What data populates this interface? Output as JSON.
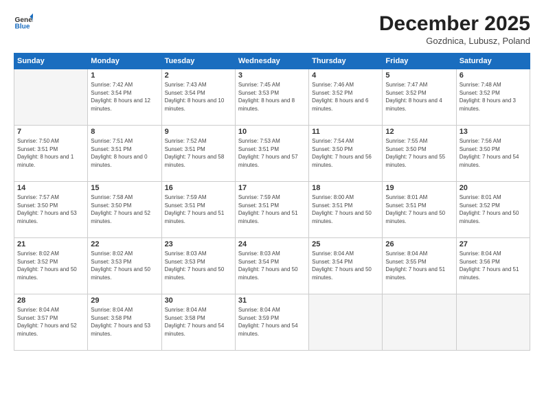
{
  "header": {
    "logo_line1": "General",
    "logo_line2": "Blue",
    "month": "December 2025",
    "location": "Gozdnica, Lubusz, Poland"
  },
  "weekdays": [
    "Sunday",
    "Monday",
    "Tuesday",
    "Wednesday",
    "Thursday",
    "Friday",
    "Saturday"
  ],
  "weeks": [
    [
      {
        "day": "",
        "empty": true
      },
      {
        "day": "1",
        "rise": "7:42 AM",
        "set": "3:54 PM",
        "daylight": "8 hours and 12 minutes."
      },
      {
        "day": "2",
        "rise": "7:43 AM",
        "set": "3:54 PM",
        "daylight": "8 hours and 10 minutes."
      },
      {
        "day": "3",
        "rise": "7:45 AM",
        "set": "3:53 PM",
        "daylight": "8 hours and 8 minutes."
      },
      {
        "day": "4",
        "rise": "7:46 AM",
        "set": "3:52 PM",
        "daylight": "8 hours and 6 minutes."
      },
      {
        "day": "5",
        "rise": "7:47 AM",
        "set": "3:52 PM",
        "daylight": "8 hours and 4 minutes."
      },
      {
        "day": "6",
        "rise": "7:48 AM",
        "set": "3:52 PM",
        "daylight": "8 hours and 3 minutes."
      }
    ],
    [
      {
        "day": "7",
        "rise": "7:50 AM",
        "set": "3:51 PM",
        "daylight": "8 hours and 1 minute."
      },
      {
        "day": "8",
        "rise": "7:51 AM",
        "set": "3:51 PM",
        "daylight": "8 hours and 0 minutes."
      },
      {
        "day": "9",
        "rise": "7:52 AM",
        "set": "3:51 PM",
        "daylight": "7 hours and 58 minutes."
      },
      {
        "day": "10",
        "rise": "7:53 AM",
        "set": "3:51 PM",
        "daylight": "7 hours and 57 minutes."
      },
      {
        "day": "11",
        "rise": "7:54 AM",
        "set": "3:50 PM",
        "daylight": "7 hours and 56 minutes."
      },
      {
        "day": "12",
        "rise": "7:55 AM",
        "set": "3:50 PM",
        "daylight": "7 hours and 55 minutes."
      },
      {
        "day": "13",
        "rise": "7:56 AM",
        "set": "3:50 PM",
        "daylight": "7 hours and 54 minutes."
      }
    ],
    [
      {
        "day": "14",
        "rise": "7:57 AM",
        "set": "3:50 PM",
        "daylight": "7 hours and 53 minutes."
      },
      {
        "day": "15",
        "rise": "7:58 AM",
        "set": "3:50 PM",
        "daylight": "7 hours and 52 minutes."
      },
      {
        "day": "16",
        "rise": "7:59 AM",
        "set": "3:51 PM",
        "daylight": "7 hours and 51 minutes."
      },
      {
        "day": "17",
        "rise": "7:59 AM",
        "set": "3:51 PM",
        "daylight": "7 hours and 51 minutes."
      },
      {
        "day": "18",
        "rise": "8:00 AM",
        "set": "3:51 PM",
        "daylight": "7 hours and 50 minutes."
      },
      {
        "day": "19",
        "rise": "8:01 AM",
        "set": "3:51 PM",
        "daylight": "7 hours and 50 minutes."
      },
      {
        "day": "20",
        "rise": "8:01 AM",
        "set": "3:52 PM",
        "daylight": "7 hours and 50 minutes."
      }
    ],
    [
      {
        "day": "21",
        "rise": "8:02 AM",
        "set": "3:52 PM",
        "daylight": "7 hours and 50 minutes."
      },
      {
        "day": "22",
        "rise": "8:02 AM",
        "set": "3:53 PM",
        "daylight": "7 hours and 50 minutes."
      },
      {
        "day": "23",
        "rise": "8:03 AM",
        "set": "3:53 PM",
        "daylight": "7 hours and 50 minutes."
      },
      {
        "day": "24",
        "rise": "8:03 AM",
        "set": "3:54 PM",
        "daylight": "7 hours and 50 minutes."
      },
      {
        "day": "25",
        "rise": "8:04 AM",
        "set": "3:54 PM",
        "daylight": "7 hours and 50 minutes."
      },
      {
        "day": "26",
        "rise": "8:04 AM",
        "set": "3:55 PM",
        "daylight": "7 hours and 51 minutes."
      },
      {
        "day": "27",
        "rise": "8:04 AM",
        "set": "3:56 PM",
        "daylight": "7 hours and 51 minutes."
      }
    ],
    [
      {
        "day": "28",
        "rise": "8:04 AM",
        "set": "3:57 PM",
        "daylight": "7 hours and 52 minutes."
      },
      {
        "day": "29",
        "rise": "8:04 AM",
        "set": "3:58 PM",
        "daylight": "7 hours and 53 minutes."
      },
      {
        "day": "30",
        "rise": "8:04 AM",
        "set": "3:58 PM",
        "daylight": "7 hours and 54 minutes."
      },
      {
        "day": "31",
        "rise": "8:04 AM",
        "set": "3:59 PM",
        "daylight": "7 hours and 54 minutes."
      },
      {
        "day": "",
        "empty": true
      },
      {
        "day": "",
        "empty": true
      },
      {
        "day": "",
        "empty": true
      }
    ]
  ]
}
